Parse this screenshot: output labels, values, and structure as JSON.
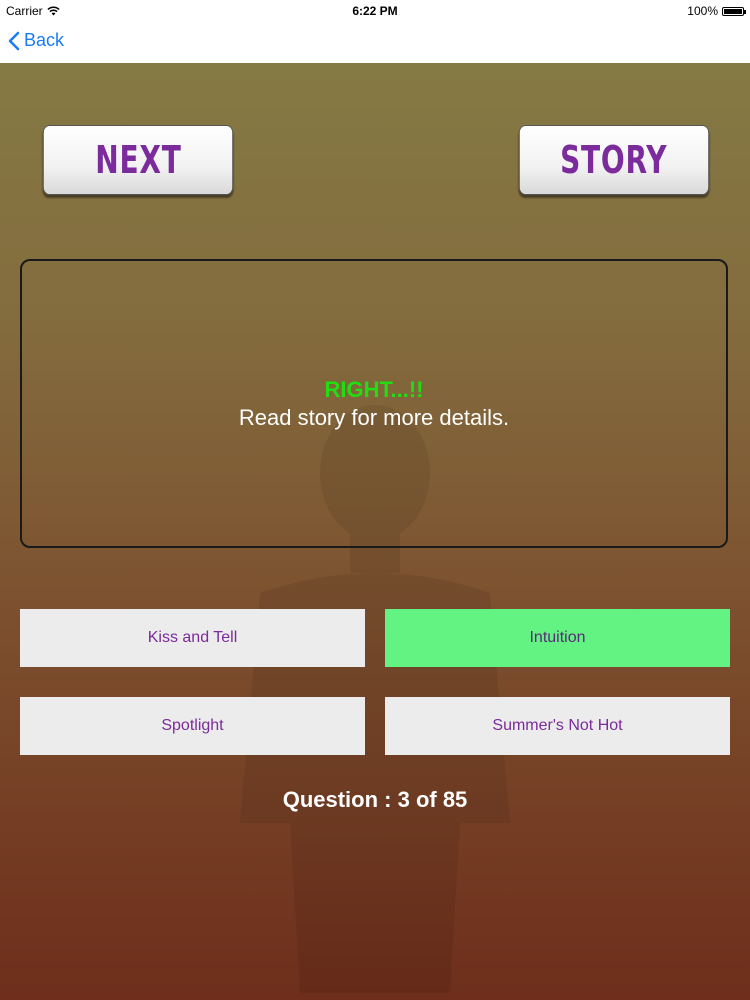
{
  "status_bar": {
    "carrier": "Carrier",
    "time": "6:22 PM",
    "battery": "100%"
  },
  "nav": {
    "back_label": "Back"
  },
  "buttons": {
    "next_label": "NEXT",
    "story_label": "STORY"
  },
  "message": {
    "result": "RIGHT...!!",
    "detail": "Read story for more details."
  },
  "answers": [
    {
      "label": "Kiss and Tell",
      "correct": false
    },
    {
      "label": "Intuition",
      "correct": true
    },
    {
      "label": "Spotlight",
      "correct": false
    },
    {
      "label": "Summer's Not Hot",
      "correct": false
    }
  ],
  "progress": {
    "text": "Question : 3 of 85",
    "current": 3,
    "total": 85
  },
  "colors": {
    "accent_purple": "#7b2b9b",
    "correct_green": "#63f382",
    "result_green": "#22dd11",
    "ios_blue": "#1a7cf5"
  },
  "icons": {
    "wifi": "wifi-icon",
    "battery": "battery-icon",
    "back": "chevron-left-icon"
  }
}
